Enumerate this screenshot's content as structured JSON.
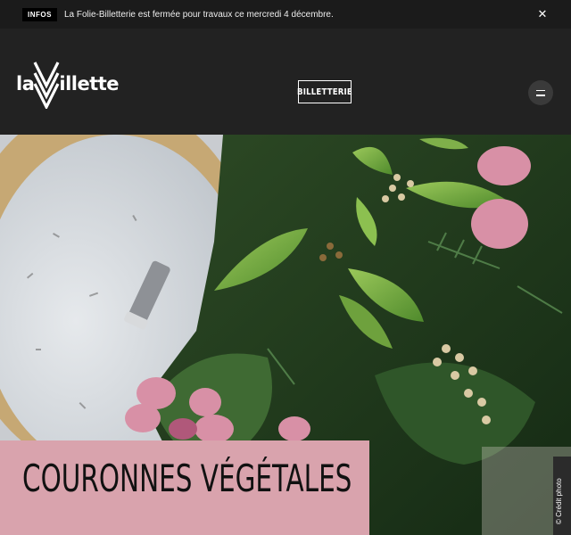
{
  "announcement": {
    "badge": "INFOS",
    "text": "La Folie-Billetterie est fermée pour travaux ce mercredi 4 décembre.",
    "close_glyph": "✕"
  },
  "header": {
    "logo_left": "la",
    "logo_right": "illette",
    "billetterie_label": "BILLETTERIE",
    "menu_icon": "hamburger-icon"
  },
  "hero": {
    "title": "COURONNES VÉGÉTALES",
    "credit": "© Crédit photo",
    "title_card_color": "#d9a3ad"
  }
}
